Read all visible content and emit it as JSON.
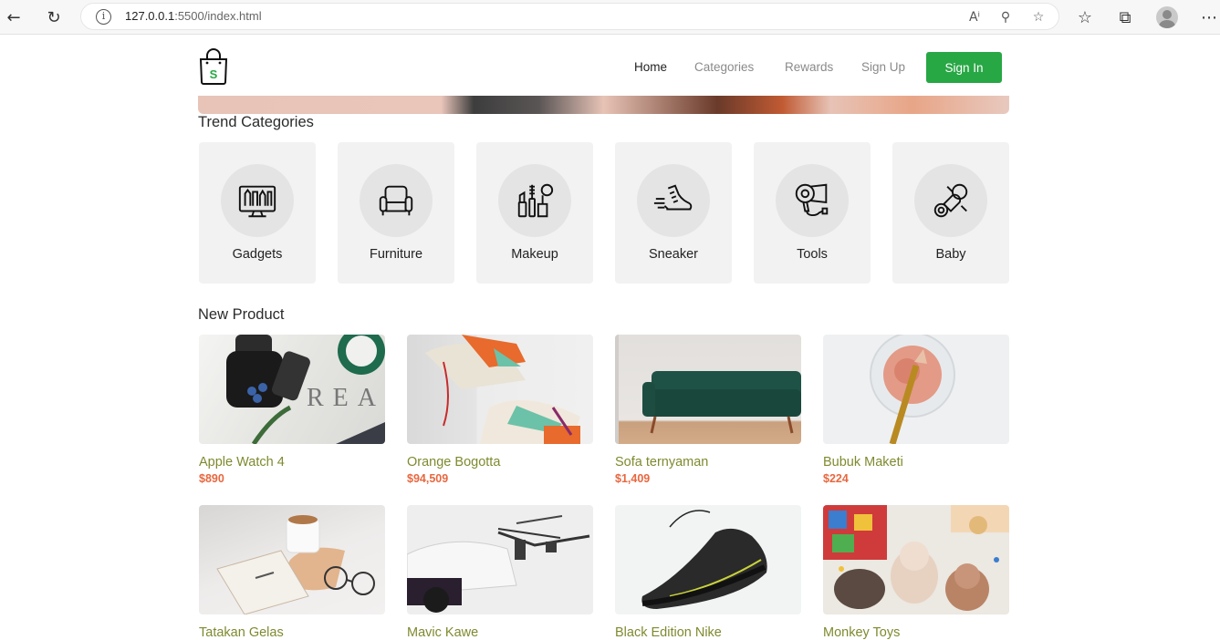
{
  "browser": {
    "url_host": "127.0.0.1",
    "url_rest": ":5500/index.html"
  },
  "nav": {
    "items": [
      {
        "label": "Home",
        "active": true
      },
      {
        "label": "Categories",
        "active": false
      },
      {
        "label": "Rewards",
        "active": false
      },
      {
        "label": "Sign Up",
        "active": false
      }
    ],
    "signin_label": "Sign In",
    "logo_letter": "S"
  },
  "colors": {
    "accent": "#28a745",
    "product_name": "#7f8a2e",
    "price": "#e8673f"
  },
  "trend": {
    "title": "Trend Categories",
    "categories": [
      {
        "label": "Gadgets",
        "icon": "gadgets-icon"
      },
      {
        "label": "Furniture",
        "icon": "armchair-icon"
      },
      {
        "label": "Makeup",
        "icon": "makeup-icon"
      },
      {
        "label": "Sneaker",
        "icon": "sneaker-icon"
      },
      {
        "label": "Tools",
        "icon": "hair-dryer-icon"
      },
      {
        "label": "Baby",
        "icon": "pacifier-icon"
      }
    ]
  },
  "products": {
    "title": "New Product",
    "items": [
      {
        "name": "Apple Watch 4",
        "price": "$890"
      },
      {
        "name": "Orange Bogotta",
        "price": "$94,509"
      },
      {
        "name": "Sofa ternyaman",
        "price": "$1,409"
      },
      {
        "name": "Bubuk Maketi",
        "price": "$224"
      },
      {
        "name": "Tatakan Gelas",
        "price": ""
      },
      {
        "name": "Mavic Kawe",
        "price": ""
      },
      {
        "name": "Black Edition Nike",
        "price": ""
      },
      {
        "name": "Monkey Toys",
        "price": ""
      }
    ]
  }
}
